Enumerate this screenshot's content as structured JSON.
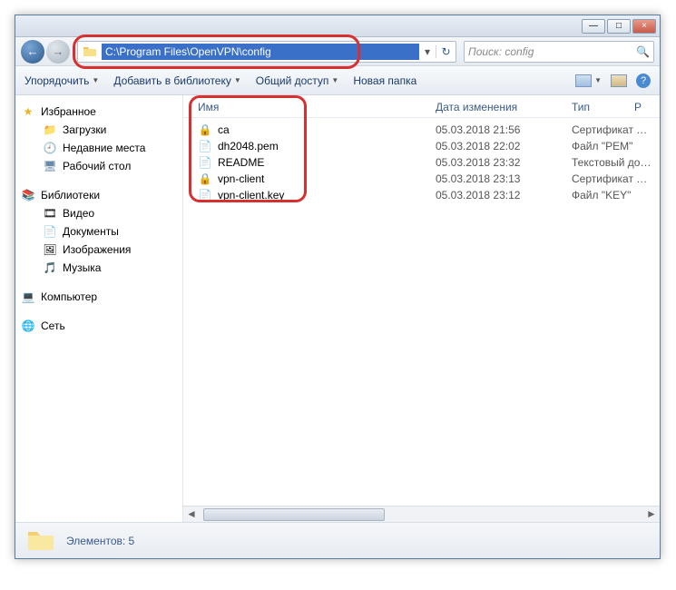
{
  "window": {
    "min": "—",
    "max": "□",
    "close": "×"
  },
  "address": {
    "path": "C:\\Program Files\\OpenVPN\\config",
    "dropdown": "▾",
    "refresh": "↻"
  },
  "search": {
    "placeholder": "Поиск: config",
    "icon": "🔍"
  },
  "toolbar": {
    "organize": "Упорядочить",
    "include": "Добавить в библиотеку",
    "share": "Общий доступ",
    "newfolder": "Новая папка",
    "help": "?"
  },
  "sidebar": {
    "favorites": "Избранное",
    "downloads": "Загрузки",
    "recent": "Недавние места",
    "desktop": "Рабочий стол",
    "libraries": "Библиотеки",
    "videos": "Видео",
    "documents": "Документы",
    "pictures": "Изображения",
    "music": "Музыка",
    "computer": "Компьютер",
    "network": "Сеть"
  },
  "columns": {
    "name": "Имя",
    "date": "Дата изменения",
    "type": "Тип",
    "r": "Р"
  },
  "files": [
    {
      "name": "ca",
      "date": "05.03.2018 21:56",
      "type": "Сертификат безо..."
    },
    {
      "name": "dh2048.pem",
      "date": "05.03.2018 22:02",
      "type": "Файл \"PEM\""
    },
    {
      "name": "README",
      "date": "05.03.2018 23:32",
      "type": "Текстовый докум..."
    },
    {
      "name": "vpn-client",
      "date": "05.03.2018 23:13",
      "type": "Сертификат безо..."
    },
    {
      "name": "vpn-client.key",
      "date": "05.03.2018 23:12",
      "type": "Файл \"KEY\""
    }
  ],
  "status": {
    "count": "Элементов: 5"
  }
}
